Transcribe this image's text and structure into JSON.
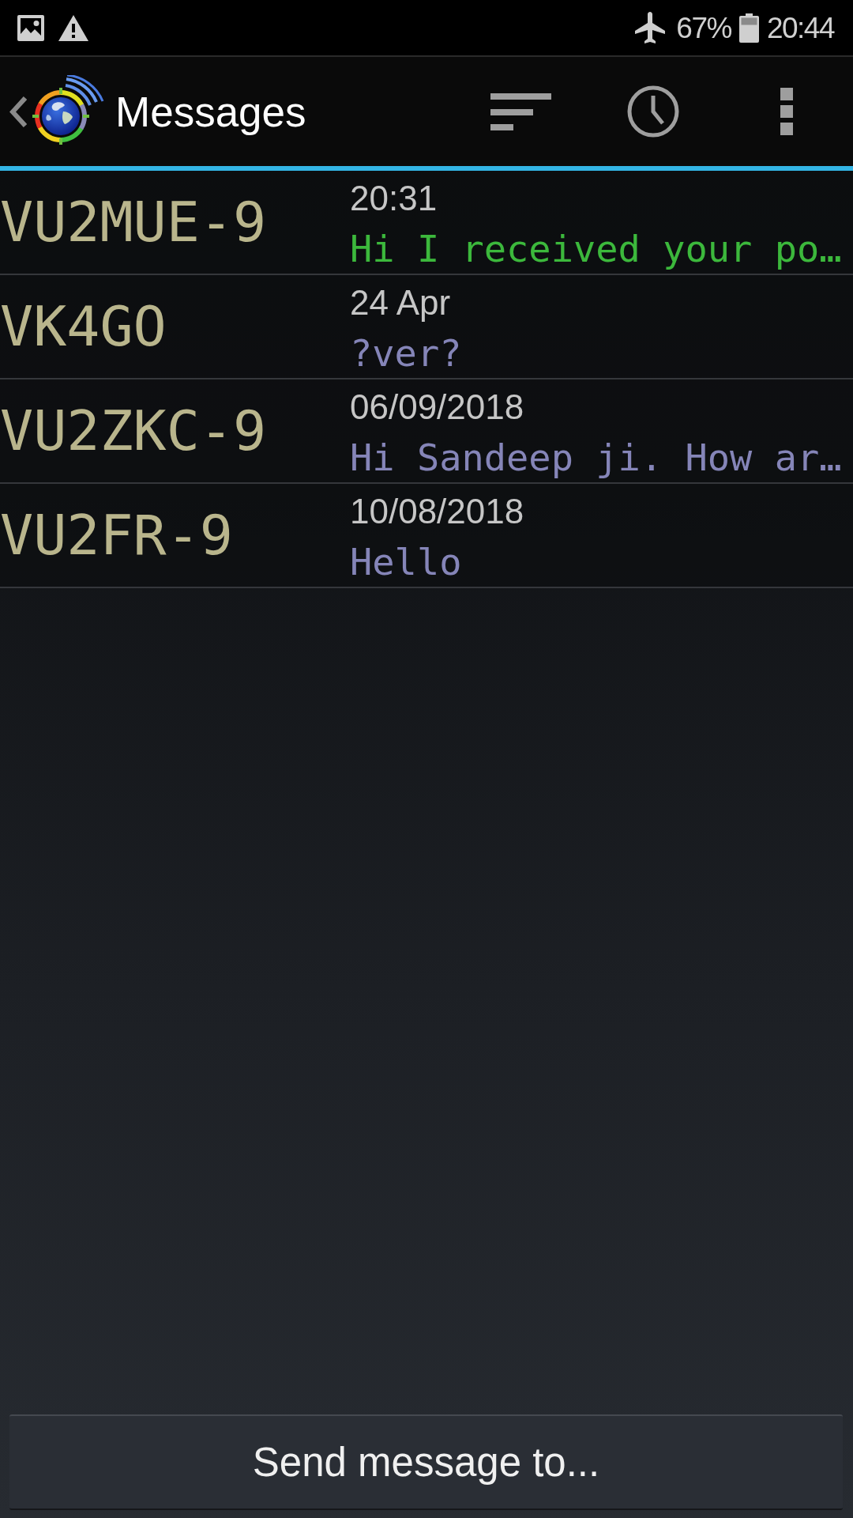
{
  "status_bar": {
    "battery": "67%",
    "time": "20:44"
  },
  "action_bar": {
    "title": "Messages"
  },
  "conversations": [
    {
      "callsign": "VU2MUE-9",
      "date": "20:31",
      "preview": "Hi I received your po…",
      "color": "#3cb83c"
    },
    {
      "callsign": "VK4GO",
      "date": "24 Apr",
      "preview": "?ver?",
      "color": "#8585b8"
    },
    {
      "callsign": "VU2ZKC-9",
      "date": "06/09/2018",
      "preview": "Hi Sandeep ji. How ar…",
      "color": "#8585b8"
    },
    {
      "callsign": "VU2FR-9",
      "date": "10/08/2018",
      "preview": "Hello",
      "color": "#8585b8"
    }
  ],
  "send_button": {
    "label": "Send message to..."
  }
}
